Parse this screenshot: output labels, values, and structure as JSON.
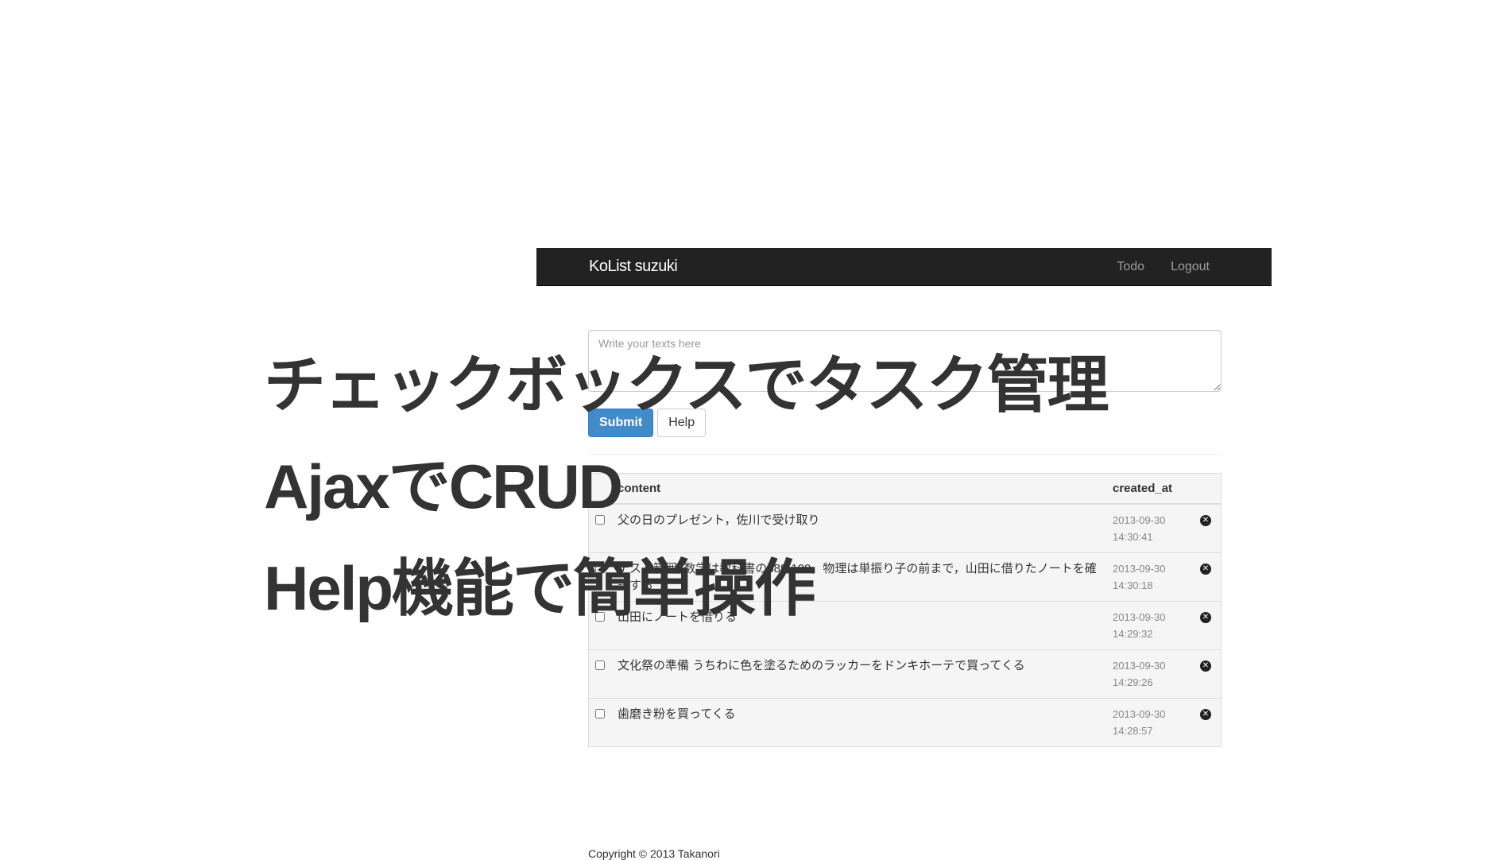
{
  "navbar": {
    "brand": "KoList suzuki",
    "links": [
      "Todo",
      "Logout"
    ]
  },
  "form": {
    "placeholder": "Write your texts here",
    "submit_label": "Submit",
    "help_label": "Help"
  },
  "table": {
    "headers": {
      "content": "content",
      "created_at": "created_at"
    },
    "rows": [
      {
        "content": "父の日のプレゼント，佐川で受け取り",
        "created_date": "2013-09-30",
        "created_time": "14:30:41"
      },
      {
        "content": "テスト範囲: 数学は教科書のp89-100，物理は単振り子の前まで，山田に借りたノートを確認する",
        "created_date": "2013-09-30",
        "created_time": "14:30:18"
      },
      {
        "content": "山田にノートを借りる",
        "created_date": "2013-09-30",
        "created_time": "14:29:32"
      },
      {
        "content": "文化祭の準備 うちわに色を塗るためのラッカーをドンキホーテで買ってくる",
        "created_date": "2013-09-30",
        "created_time": "14:29:26"
      },
      {
        "content": "歯磨き粉を買ってくる",
        "created_date": "2013-09-30",
        "created_time": "14:28:57"
      }
    ]
  },
  "footer": {
    "copyright": "Copyright © 2013 Takanori"
  },
  "overlay": {
    "lines": [
      "チェックボックスでタスク管理",
      "AjaxでCRUD",
      "Help機能で簡単操作"
    ]
  },
  "icons": {
    "delete": "remove-sign-icon"
  },
  "colors": {
    "navbar_bg": "#222222",
    "primary": "#428bca",
    "table_bg": "#f5f5f5"
  }
}
